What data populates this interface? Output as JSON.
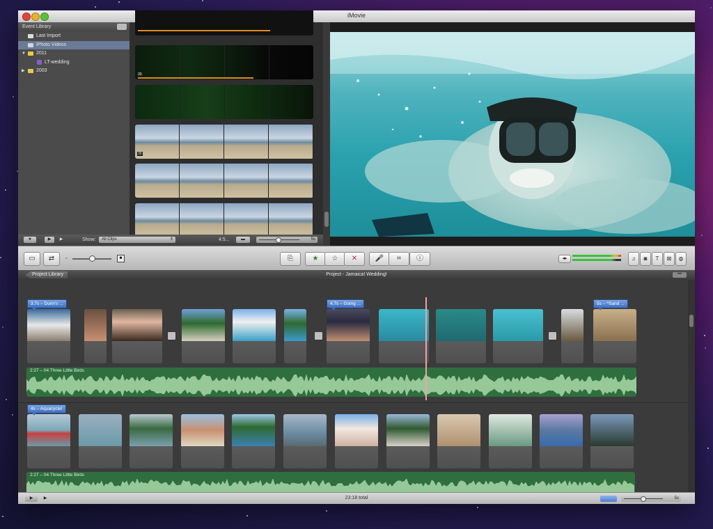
{
  "app": {
    "title": "iMovie"
  },
  "event_library": {
    "header": "Event Library",
    "items": [
      {
        "label": "Last Import",
        "level": 1,
        "icon": "film-roll-icon"
      },
      {
        "label": "iPhoto Videos",
        "level": 1,
        "icon": "iphoto-icon",
        "selected": true
      },
      {
        "label": "2011",
        "level": 0,
        "icon": "folder-icon",
        "expanded": true
      },
      {
        "label": "LT-wedding",
        "level": 2,
        "icon": "event-star-icon"
      },
      {
        "label": "2003",
        "level": 0,
        "icon": "folder-icon",
        "expanded": false
      }
    ]
  },
  "event_browser": {
    "clips": [
      {
        "badge": "",
        "duration_bar": 0.76
      },
      {
        "badge": "30",
        "duration_bar": 0.68
      },
      {
        "badge": "",
        "duration_bar": 0
      },
      {
        "badge": "30",
        "duration_bar": 0
      },
      {
        "badge": "",
        "duration_bar": 0
      },
      {
        "badge": "",
        "duration_bar": 0
      }
    ]
  },
  "event_bar": {
    "show_label": "Show:",
    "show_value": "All Clips",
    "duration": "4:5...",
    "zoom_label": "5s"
  },
  "project": {
    "back_label": "Project Library",
    "title": "Project - Jamaica! Wedding!",
    "row1_titles": [
      "3.7s – Dunn's ...",
      "4.7s – Going ...",
      "5s – ^Sand ..."
    ],
    "row2_titles": [
      "4s – Aquacycle!"
    ],
    "audio_label_1": "2:27 – 04 Three Little Birds",
    "audio_label_2": "2:27 – 04 Three Little Birds"
  },
  "bottom_bar": {
    "total": "23:18 total",
    "zoom_label": "5s"
  },
  "colors": {
    "selection": "#6b7a96",
    "audio_track": "#2f6e3e",
    "title_tag": "#3e6fc0",
    "playhead": "#f2a2a8",
    "clip_bar": "#e08a1c"
  }
}
